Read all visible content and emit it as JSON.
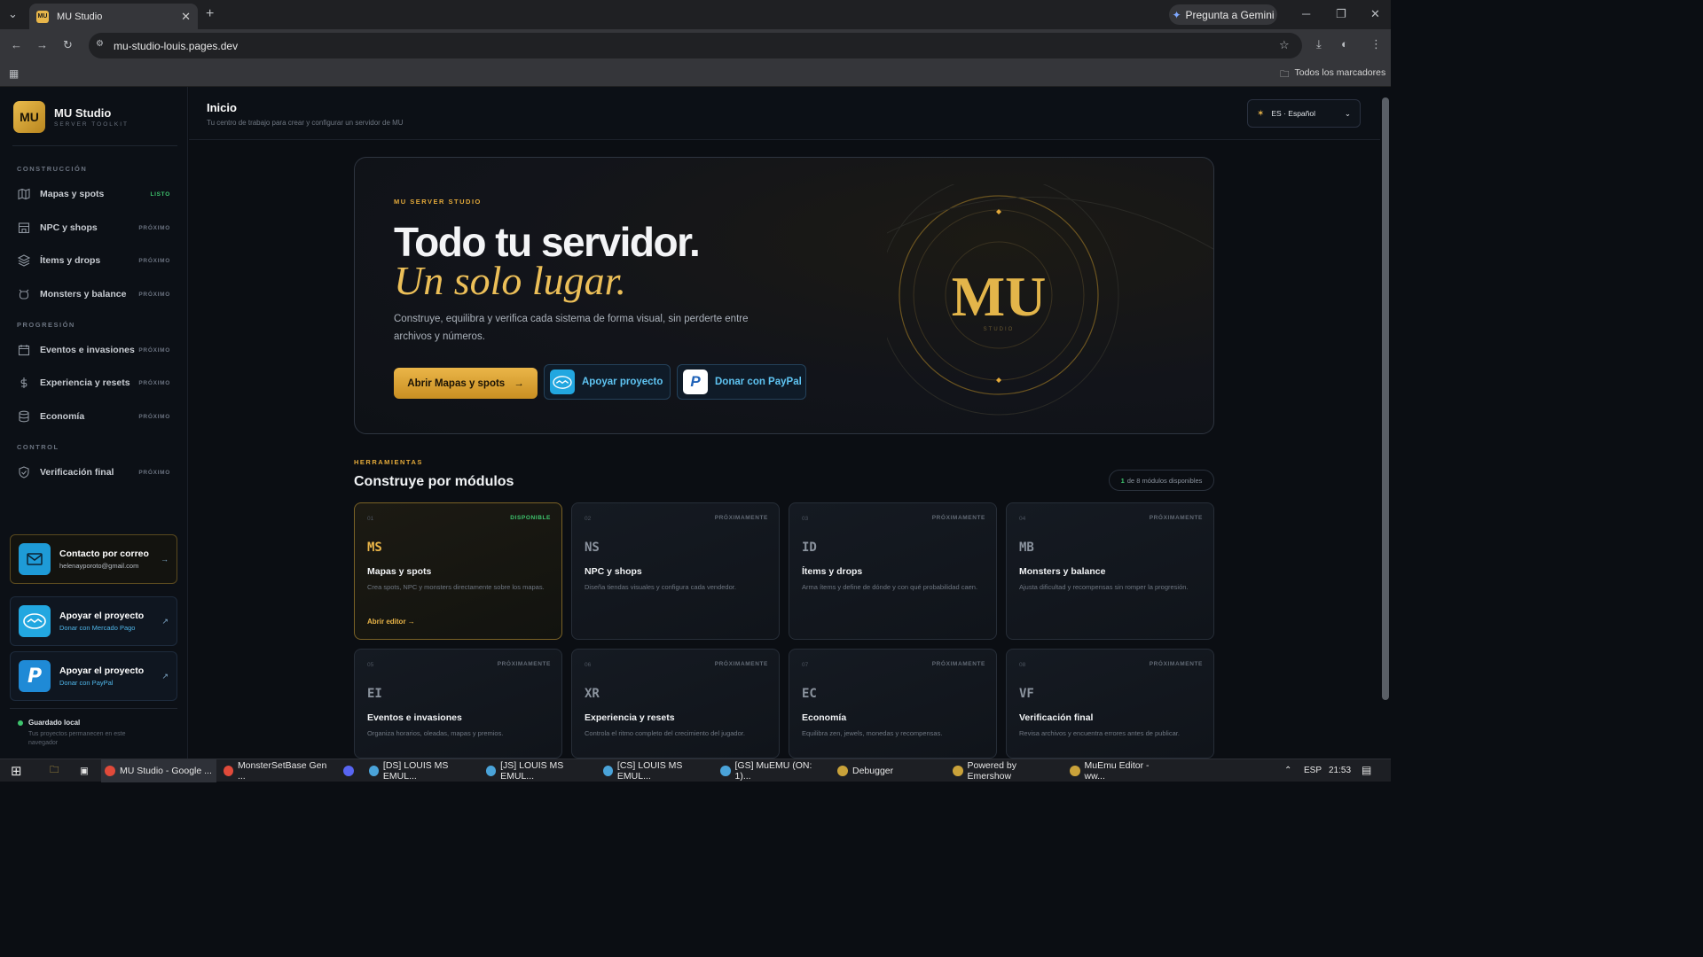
{
  "browser": {
    "tab_title": "MU Studio",
    "tab_favicon": "MU",
    "gemini_label": "Pregunta a Gemini",
    "url": "mu-studio-louis.pages.dev",
    "bookmarks_label": "Todos los marcadores"
  },
  "brand": {
    "logo": "MU",
    "name": "MU Studio",
    "tagline": "SERVER TOOLKIT"
  },
  "sidebar": {
    "sections": [
      "CONSTRUCCIÓN",
      "PROGRESIÓN",
      "CONTROL"
    ],
    "items": [
      {
        "label": "Mapas y spots",
        "badge": "LISTO",
        "icon": "map-icon"
      },
      {
        "label": "NPC y shops",
        "badge": "PRÓXIMO",
        "icon": "shop-icon"
      },
      {
        "label": "Ítems y drops",
        "badge": "PRÓXIMO",
        "icon": "layers-icon"
      },
      {
        "label": "Monsters y balance",
        "badge": "PRÓXIMO",
        "icon": "monster-icon"
      },
      {
        "label": "Eventos e invasiones",
        "badge": "PRÓXIMO",
        "icon": "calendar-icon"
      },
      {
        "label": "Experiencia y resets",
        "badge": "PRÓXIMO",
        "icon": "dollar-icon"
      },
      {
        "label": "Economía",
        "badge": "PRÓXIMO",
        "icon": "database-icon"
      },
      {
        "label": "Verificación final",
        "badge": "PRÓXIMO",
        "icon": "shield-check-icon"
      }
    ],
    "contact": {
      "title": "Contacto por correo",
      "email": "helenayporoto@gmail.com"
    },
    "support_mp": {
      "title": "Apoyar el proyecto",
      "sub": "Donar con Mercado Pago"
    },
    "support_pp": {
      "title": "Apoyar el proyecto",
      "sub": "Donar con PayPal"
    },
    "saved": {
      "title": "Guardado local",
      "desc": "Tus proyectos permanecen en este navegador"
    }
  },
  "header": {
    "title": "Inicio",
    "subtitle": "Tu centro de trabajo para crear y configurar un servidor de MU",
    "language": "ES · Español"
  },
  "hero": {
    "kicker": "MU SERVER STUDIO",
    "line1": "Todo tu servidor.",
    "line2": "Un solo lugar.",
    "description": "Construye, equilibra y verifica cada sistema de forma visual, sin perderte entre archivos y números.",
    "primary_button": "Abrir Mapas y spots",
    "secondary_button": "Apoyar proyecto",
    "paypal_button": "Donar con PayPal",
    "emblem_text": "MU",
    "emblem_sub": "STUDIO"
  },
  "modules": {
    "kicker": "HERRAMIENTAS",
    "title": "Construye por módulos",
    "available_count": "1",
    "available_text": "de 8 módulos disponibles",
    "cards": [
      {
        "num": "01",
        "status": "DISPONIBLE",
        "abbr": "MS",
        "name": "Mapas y spots",
        "desc": "Crea spots, NPC y monsters directamente sobre los mapas.",
        "link": "Abrir editor →"
      },
      {
        "num": "02",
        "status": "PRÓXIMAMENTE",
        "abbr": "NS",
        "name": "NPC y shops",
        "desc": "Diseña tiendas visuales y configura cada vendedor."
      },
      {
        "num": "03",
        "status": "PRÓXIMAMENTE",
        "abbr": "ID",
        "name": "Ítems y drops",
        "desc": "Arma ítems y define de dónde y con qué probabilidad caen."
      },
      {
        "num": "04",
        "status": "PRÓXIMAMENTE",
        "abbr": "MB",
        "name": "Monsters y balance",
        "desc": "Ajusta dificultad y recompensas sin romper la progresión."
      },
      {
        "num": "05",
        "status": "PRÓXIMAMENTE",
        "abbr": "EI",
        "name": "Eventos e invasiones",
        "desc": "Organiza horarios, oleadas, mapas y premios."
      },
      {
        "num": "06",
        "status": "PRÓXIMAMENTE",
        "abbr": "XR",
        "name": "Experiencia y resets",
        "desc": "Controla el ritmo completo del crecimiento del jugador."
      },
      {
        "num": "07",
        "status": "PRÓXIMAMENTE",
        "abbr": "EC",
        "name": "Economía",
        "desc": "Equilibra zen, jewels, monedas y recompensas."
      },
      {
        "num": "08",
        "status": "PRÓXIMAMENTE",
        "abbr": "VF",
        "name": "Verificación final",
        "desc": "Revisa archivos y encuentra errores antes de publicar."
      }
    ]
  },
  "taskbar": {
    "items": [
      "MU Studio - Google ...",
      "MonsterSetBase Gen ...",
      "[DS] LOUIS MS EMUL...",
      "[JS] LOUIS MS EMUL...",
      "[CS] LOUIS MS EMUL...",
      "[GS] MuEMU (ON: 1)...",
      "Debugger",
      "Powered by Emershow",
      "MuEmu Editor - ww..."
    ],
    "lang": "ESP",
    "time": "21:53"
  },
  "colors": {
    "accent": "#eab548",
    "success": "#3ec46d",
    "link": "#5fc4f2",
    "bg": "#0b0e13"
  }
}
